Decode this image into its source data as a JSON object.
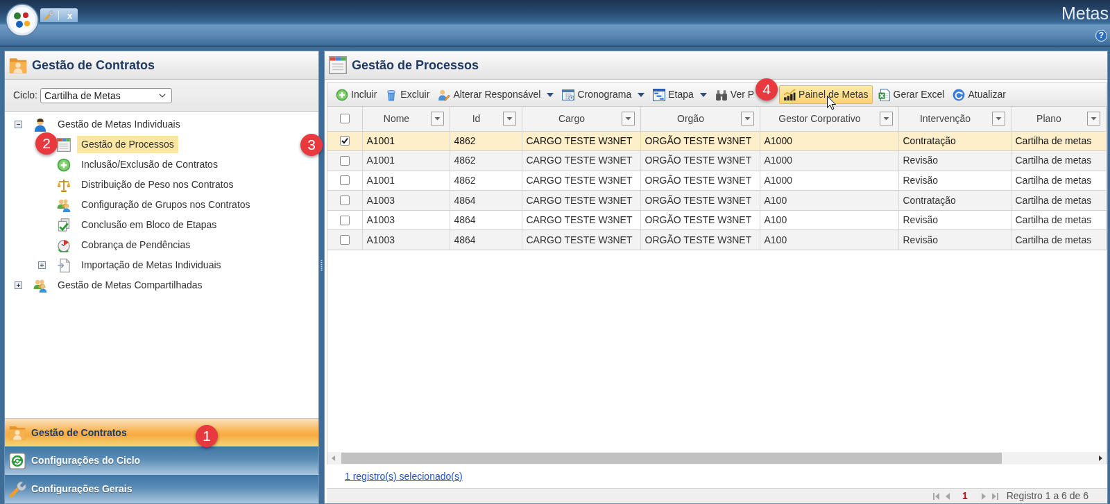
{
  "app": {
    "tab_close": "x",
    "title": "Metas",
    "help": "?"
  },
  "left_panel": {
    "title": "Gestão de Contratos",
    "cycle": {
      "label": "Ciclo:",
      "value": "Cartilha de Metas"
    },
    "tree": [
      {
        "label": "Gestão de Metas Individuais",
        "expanded": true,
        "selected": false,
        "children": [
          {
            "label": "Gestão de Processos",
            "selected": true
          },
          {
            "label": "Inclusão/Exclusão de Contratos",
            "selected": false
          },
          {
            "label": "Distribuição de Peso nos Contratos",
            "selected": false
          },
          {
            "label": "Configuração de Grupos nos Contratos",
            "selected": false
          },
          {
            "label": "Conclusão em Bloco de Etapas",
            "selected": false
          },
          {
            "label": "Cobrança de Pendências",
            "selected": false
          },
          {
            "label": "Importação de Metas Individuais",
            "expanded": false,
            "selected": false
          }
        ]
      },
      {
        "label": "Gestão de Metas Compartilhadas",
        "expanded": false,
        "selected": false
      }
    ],
    "accordion": [
      {
        "label": "Gestão de Contratos",
        "selected": true
      },
      {
        "label": "Configurações do Ciclo",
        "selected": false
      },
      {
        "label": "Configurações Gerais",
        "selected": false
      }
    ]
  },
  "main_panel": {
    "title": "Gestão de Processos",
    "toolbar": [
      {
        "label": "Incluir",
        "dropdown": false,
        "hovered": false
      },
      {
        "label": "Excluir",
        "dropdown": false,
        "hovered": false
      },
      {
        "label": "Alterar Responsável",
        "dropdown": true,
        "hovered": false
      },
      {
        "label": "Cronograma",
        "dropdown": true,
        "hovered": false
      },
      {
        "label": "Etapa",
        "dropdown": true,
        "hovered": false
      },
      {
        "label": "Ver P",
        "dropdown": false,
        "hovered": false
      },
      {
        "label": "Painel de Metas",
        "dropdown": false,
        "hovered": true
      },
      {
        "label": "Gerar Excel",
        "dropdown": false,
        "hovered": false
      },
      {
        "label": "Atualizar",
        "dropdown": false,
        "hovered": false
      }
    ],
    "grid": {
      "select_all": {
        "checked": false
      },
      "columns": [
        "Nome",
        "Id",
        "Cargo",
        "Orgão",
        "Gestor Corporativo",
        "Intervenção",
        "Plano"
      ],
      "rows": [
        {
          "selected": true,
          "cells": [
            "A1001",
            "4862",
            "CARGO TESTE W3NET",
            "ORGÃO TESTE W3NET",
            "A1000",
            "Contratação",
            "Cartilha de metas"
          ]
        },
        {
          "selected": false,
          "cells": [
            "A1001",
            "4862",
            "CARGO TESTE W3NET",
            "ORGÃO TESTE W3NET",
            "A1000",
            "Revisão",
            "Cartilha de metas"
          ]
        },
        {
          "selected": false,
          "cells": [
            "A1001",
            "4862",
            "CARGO TESTE W3NET",
            "ORGÃO TESTE W3NET",
            "A1000",
            "Revisão",
            "Cartilha de metas"
          ]
        },
        {
          "selected": false,
          "cells": [
            "A1003",
            "4864",
            "CARGO TESTE W3NET",
            "ORGÃO TESTE W3NET",
            "A100",
            "Contratação",
            "Cartilha de metas"
          ]
        },
        {
          "selected": false,
          "cells": [
            "A1003",
            "4864",
            "CARGO TESTE W3NET",
            "ORGÃO TESTE W3NET",
            "A100",
            "Revisão",
            "Cartilha de metas"
          ]
        },
        {
          "selected": false,
          "cells": [
            "A1003",
            "4864",
            "CARGO TESTE W3NET",
            "ORGÃO TESTE W3NET",
            "A100",
            "Revisão",
            "Cartilha de metas"
          ]
        }
      ]
    },
    "selection_link": "1 registro(s) selecionado(s)",
    "pager": {
      "current_page": "1",
      "summary": "Registro 1 a 6 de 6"
    }
  },
  "annotations": [
    {
      "label": "1"
    },
    {
      "label": "2"
    },
    {
      "label": "3"
    },
    {
      "label": "4"
    }
  ]
}
